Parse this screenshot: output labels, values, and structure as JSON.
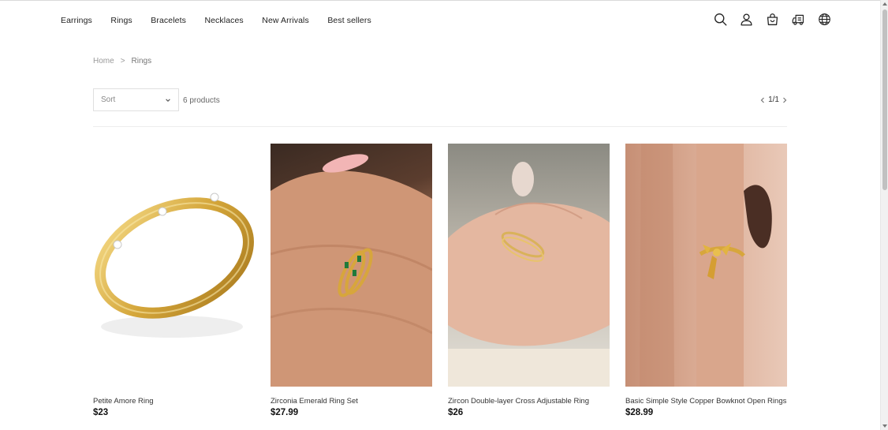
{
  "nav": {
    "items": [
      "Earrings",
      "Rings",
      "Bracelets",
      "Necklaces",
      "New Arrivals",
      "Best sellers"
    ]
  },
  "header_icons": [
    "search-icon",
    "account-icon",
    "cart-icon",
    "order-tracking-icon",
    "language-globe-icon"
  ],
  "breadcrumb": {
    "home": "Home",
    "separator": ">",
    "current": "Rings"
  },
  "toolbar": {
    "sort_label": "Sort",
    "product_count": "6 products",
    "page_indicator": "1/1"
  },
  "products": [
    {
      "title": "Petite Amore Ring",
      "price": "$23"
    },
    {
      "title": "Zirconia Emerald Ring Set",
      "price": "$27.99"
    },
    {
      "title": "Zircon Double-layer Cross Adjustable Ring",
      "price": "$26"
    },
    {
      "title": "Basic Simple Style Copper Bowknot Open Rings",
      "price": "$28.99"
    }
  ],
  "colors": {
    "text": "#222222",
    "muted": "#999999",
    "gold": "#d9a83a",
    "skin": "#c98f6e"
  }
}
